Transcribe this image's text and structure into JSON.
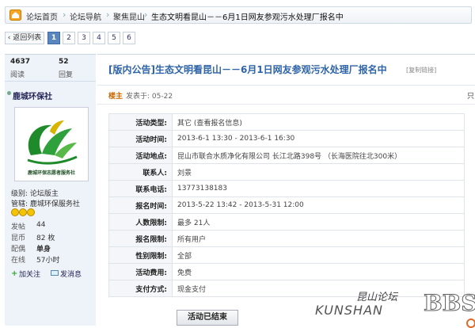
{
  "breadcrumb": {
    "items": [
      "论坛首页",
      "论坛导航",
      "聚焦昆山"
    ],
    "current": "生态文明看昆山－－6月1日网友参观污水处理厂报名中"
  },
  "pager": {
    "back_label": "‹ 返回列表",
    "pages": [
      "1",
      "2",
      "3",
      "4",
      "5",
      "6"
    ],
    "current_page": "1"
  },
  "user": {
    "views": "4637",
    "views_label": "阅读",
    "replies": "52",
    "replies_label": "回复",
    "name": "鹿城环保社",
    "avatar_caption": "鹿城环保志愿者服务社",
    "level": "级别: 论坛版主",
    "admin": "管辖: 鹿城环保服务社",
    "posts_label": "发帖",
    "posts": "44",
    "coins_label": "昆币",
    "coins": "82 枚",
    "partner_label": "配偶",
    "partner": "单身",
    "online_label": "在线",
    "online": "57小时",
    "follow_label": "加关注",
    "message_label": "发消息"
  },
  "post": {
    "title": "[版内公告]生态文明看昆山－－6月1日网友参观污水处理厂报名中",
    "copy_link": "[复制链接]",
    "owner_tag": "楼主",
    "posted": "发表于: 05-22",
    "edge_char": "只",
    "rows": [
      {
        "key": "活动类型:",
        "value": "其它 (查看报名信息)"
      },
      {
        "key": "活动时间:",
        "value": "2013-6-1 13:30 - 2013-6-1 16:30"
      },
      {
        "key": "活动地点:",
        "value": "昆山市联合水质净化有限公司  长江北路398号 （长海医院往北300米）"
      },
      {
        "key": "联系人:",
        "value": "刘景"
      },
      {
        "key": "联系电话:",
        "value": "13773138183"
      },
      {
        "key": "报名时间:",
        "value": "2013-5-22 13:42 - 2013-5-31 12:00"
      },
      {
        "key": "人数限制:",
        "value": "最多 21人"
      },
      {
        "key": "报名限制:",
        "value": "所有用户"
      },
      {
        "key": "性别限制:",
        "value": "全部"
      },
      {
        "key": "活动费用:",
        "value": "免费"
      },
      {
        "key": "支付方式:",
        "value": "现金支付"
      }
    ],
    "ended_button": "活动已结束"
  },
  "watermark": {
    "cn": "昆山论坛",
    "en": "KUNSHAN",
    "bbs": "BBS"
  },
  "colors": {
    "title_blue": "#2d63a8",
    "page_active": "#5a86c0",
    "side_bg": "#eef3f9"
  }
}
